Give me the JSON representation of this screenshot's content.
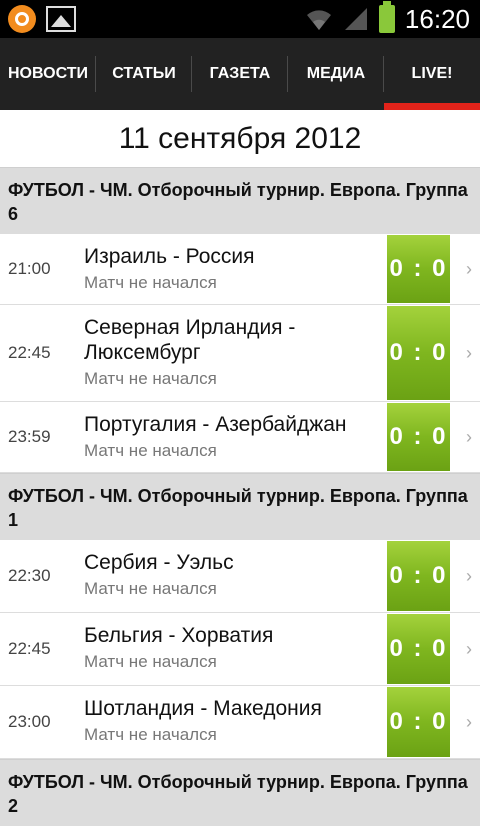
{
  "status_bar": {
    "time": "16:20"
  },
  "nav": {
    "tabs": [
      {
        "label": "НОВОСТИ",
        "active": false
      },
      {
        "label": "СТАТЬИ",
        "active": false
      },
      {
        "label": "ГАЗЕТА",
        "active": false
      },
      {
        "label": "МЕДИА",
        "active": false
      },
      {
        "label": "LIVE!",
        "active": true
      }
    ],
    "active_color": "#e2231a"
  },
  "date_header": "11 сентября 2012",
  "groups": [
    {
      "title": "ФУТБОЛ - ЧМ. Отборочный турнир. Европа. Группа 6",
      "matches": [
        {
          "time": "21:00",
          "teams": "Израиль - Россия",
          "status": "Матч не начался",
          "score": "0 : 0"
        },
        {
          "time": "22:45",
          "teams": "Северная Ирландия - Люксембург",
          "status": "Матч не начался",
          "score": "0 : 0"
        },
        {
          "time": "23:59",
          "teams": "Португалия - Азербайджан",
          "status": "Матч не начался",
          "score": "0 : 0"
        }
      ]
    },
    {
      "title": "ФУТБОЛ - ЧМ. Отборочный турнир. Европа. Группа 1",
      "matches": [
        {
          "time": "22:30",
          "teams": "Сербия - Уэльс",
          "status": "Матч не начался",
          "score": "0 : 0"
        },
        {
          "time": "22:45",
          "teams": "Бельгия - Хорватия",
          "status": "Матч не начался",
          "score": "0 : 0"
        },
        {
          "time": "23:00",
          "teams": "Шотландия - Македония",
          "status": "Матч не начался",
          "score": "0 : 0"
        }
      ]
    },
    {
      "title": "ФУТБОЛ - ЧМ. Отборочный турнир. Европа. Группа 2",
      "matches": []
    }
  ],
  "icons": {
    "app": "app-logo-icon",
    "image": "image-notification-icon",
    "wifi": "wifi-icon",
    "signal": "signal-icon",
    "battery": "battery-icon",
    "chevron": "›"
  }
}
